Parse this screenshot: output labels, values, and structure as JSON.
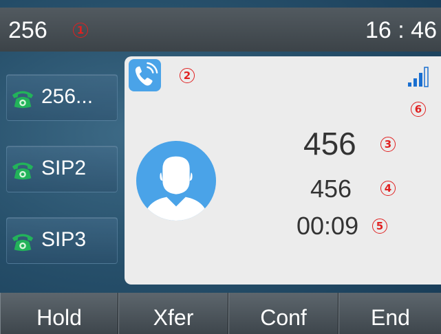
{
  "status_bar": {
    "account": "256",
    "time": "16 : 46"
  },
  "markers": [
    "1",
    "2",
    "3",
    "4",
    "5",
    "6"
  ],
  "line_keys": [
    {
      "label": "256...",
      "icon": "green-phone-icon"
    },
    {
      "label": "SIP2",
      "icon": "green-phone-icon"
    },
    {
      "label": "SIP3",
      "icon": "green-phone-icon"
    }
  ],
  "call": {
    "name": "456",
    "number": "456",
    "duration": "00:09"
  },
  "softkeys": [
    "Hold",
    "Xfer",
    "Conf",
    "End"
  ],
  "colors": {
    "accent_blue": "#4aa3e8",
    "phone_green": "#22b35a",
    "marker_red": "#e02020",
    "signal_blue": "#1a6fd0"
  }
}
